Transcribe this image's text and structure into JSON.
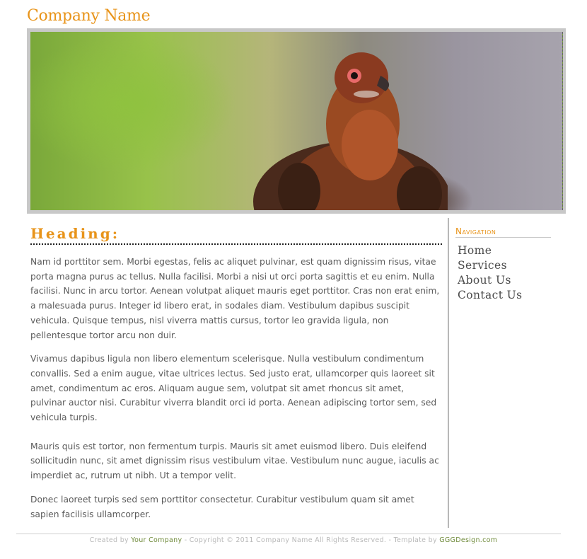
{
  "header": {
    "company_name": "Company Name"
  },
  "banner": {
    "icon": "grouse-photo"
  },
  "main": {
    "heading": "Heading:",
    "paragraphs": [
      "Nam id porttitor sem. Morbi egestas, felis ac aliquet pulvinar, est quam dignissim risus, vitae porta magna purus ac tellus. Nulla facilisi. Morbi a nisi ut orci porta sagittis et eu enim. Nulla facilisi. Nunc in arcu tortor. Aenean volutpat aliquet mauris eget porttitor. Cras non erat enim, a malesuada purus. Integer id libero erat, in sodales diam. Vestibulum dapibus suscipit vehicula. Quisque tempus, nisl viverra mattis cursus, tortor leo gravida ligula, non pellentesque tortor arcu non duir.",
      "Vivamus dapibus ligula non libero elementum scelerisque. Nulla vestibulum condimentum convallis. Sed a enim augue, vitae ultrices lectus. Sed justo erat, ullamcorper quis laoreet sit amet, condimentum ac eros. Aliquam augue sem, volutpat sit amet rhoncus sit amet, pulvinar auctor nisi. Curabitur viverra blandit orci id porta. Aenean adipiscing tortor sem, sed vehicula turpis.",
      "Mauris quis est tortor, non fermentum turpis. Mauris sit amet euismod libero. Duis eleifend sollicitudin nunc, sit amet dignissim risus vestibulum vitae. Vestibulum nunc augue, iaculis ac imperdiet ac, rutrum ut nibh. Ut a tempor velit.",
      "Donec laoreet turpis sed sem porttitor consectetur. Curabitur vestibulum quam sit amet sapien facilisis ullamcorper."
    ]
  },
  "sidebar": {
    "title": "Navigation",
    "items": [
      {
        "label": "Home"
      },
      {
        "label": "Services"
      },
      {
        "label": "About Us"
      },
      {
        "label": "Contact Us"
      }
    ]
  },
  "footer": {
    "created_by": "Created by",
    "company_link": "Your Company",
    "copyright": "- Copyright © 2011 Company Name All Rights Reserved. -  Template by",
    "template_link": "GGGDesign.com"
  },
  "colors": {
    "accent": "#e8941a",
    "footer_link": "#6f8a3a"
  }
}
